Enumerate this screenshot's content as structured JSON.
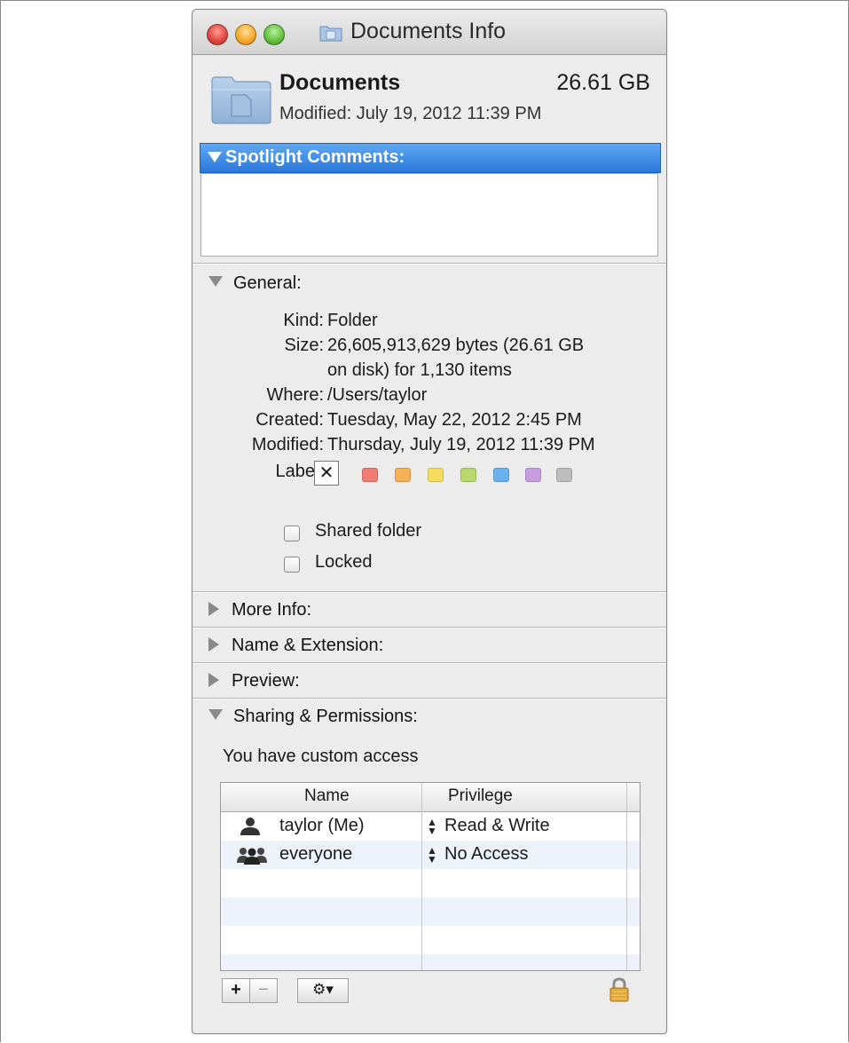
{
  "window": {
    "title": "Documents Info"
  },
  "header": {
    "name": "Documents",
    "size": "26.61 GB",
    "modified": "Modified: July 19, 2012 11:39 PM"
  },
  "spotlight": {
    "label": "Spotlight Comments:",
    "value": ""
  },
  "general": {
    "label": "General:",
    "rows": [
      {
        "key": "Kind:",
        "value": "Folder"
      },
      {
        "key": "Size:",
        "value": "26,605,913,629 bytes (26.61 GB"
      },
      {
        "key": "",
        "value": "on disk) for 1,130 items"
      },
      {
        "key": "Where:",
        "value": "/Users/taylor"
      },
      {
        "key": "Created:",
        "value": "Tuesday, May 22, 2012 2:45 PM"
      },
      {
        "key": "Modified:",
        "value": "Thursday, July 19, 2012 11:39 PM"
      }
    ],
    "label_key": "Label:",
    "label_none": "✕",
    "label_colors": [
      "#f07d74",
      "#f6b155",
      "#f3dc5e",
      "#b8d86b",
      "#6ab2ef",
      "#c69ee0",
      "#bdbdbd"
    ],
    "shared_folder": {
      "label": "Shared folder",
      "checked": false
    },
    "locked": {
      "label": "Locked",
      "checked": false
    }
  },
  "collapsed_sections": [
    "More Info:",
    "Name & Extension:",
    "Preview:"
  ],
  "sharing": {
    "label": "Sharing & Permissions:",
    "access_text": "You have custom access",
    "columns": [
      "Name",
      "Privilege"
    ],
    "rows": [
      {
        "name": "taylor (Me)",
        "privilege": "Read & Write",
        "icon": "user-icon"
      },
      {
        "name": "everyone",
        "privilege": "No Access",
        "icon": "group-icon"
      }
    ],
    "buttons": {
      "add": "+",
      "remove": "−",
      "action": "⚙▾"
    }
  },
  "colors": {
    "selection_blue": "#3a86e0",
    "window_bg": "#ececec",
    "row_alt": "#eef3fb"
  }
}
